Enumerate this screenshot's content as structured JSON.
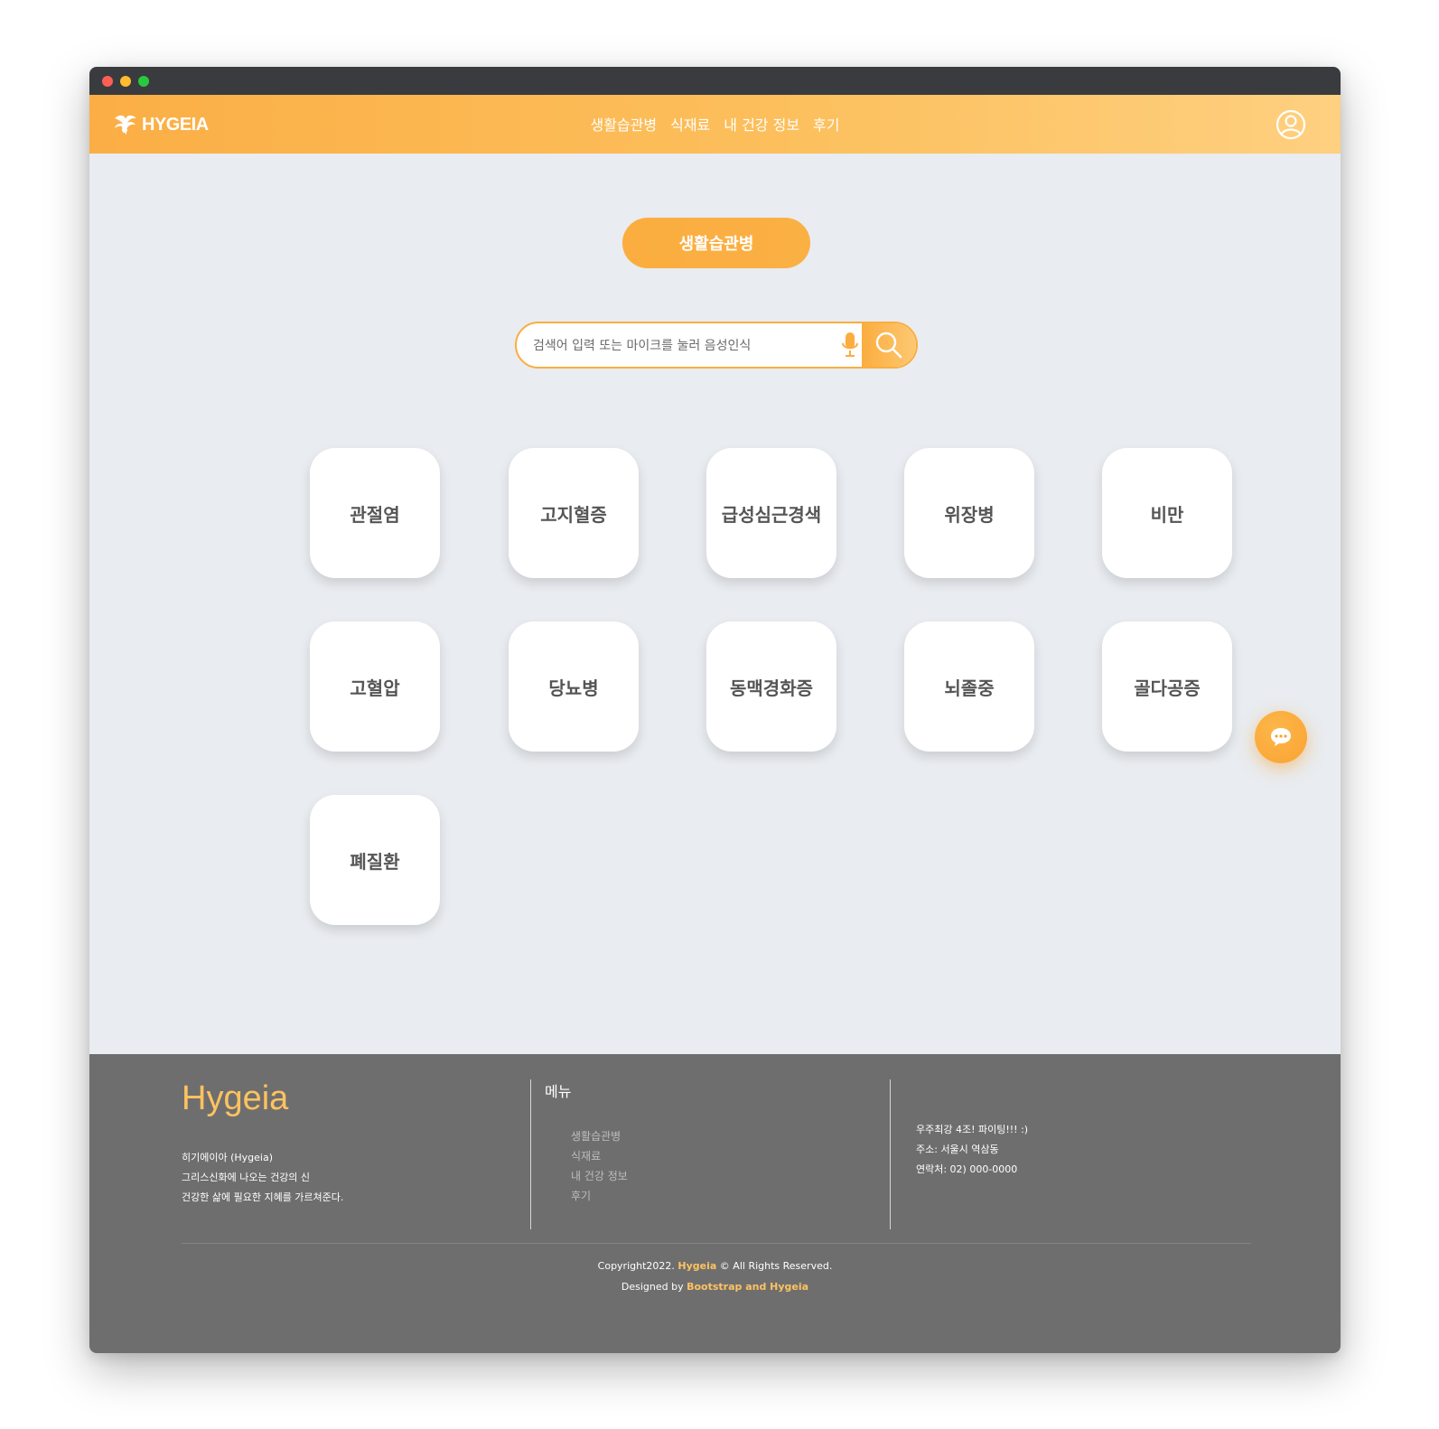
{
  "brand": {
    "name": "HYGEIA"
  },
  "nav": {
    "links": [
      "생활습관병",
      "식재료",
      "내 건강 정보",
      "후기"
    ]
  },
  "category": {
    "label": "생활습관병"
  },
  "search": {
    "placeholder": "검색어 입력 또는 마이크를 눌러 음성인식"
  },
  "diseases": [
    "관절염",
    "고지혈증",
    "급성심근경색",
    "위장병",
    "비만",
    "고혈압",
    "당뇨병",
    "동맥경화증",
    "뇌졸중",
    "골다공증",
    "폐질환"
  ],
  "footer": {
    "brand": "Hygeia",
    "desc_lines": [
      "히기에이아 (Hygeia)",
      "그리스신화에 나오는 건강의 신",
      "건강한 삶에 필요한 지혜를 가르쳐준다."
    ],
    "menu_title": "메뉴",
    "menu_items": [
      "생활습관병",
      "식재료",
      "내 건강 정보",
      "후기"
    ],
    "contact_lines": [
      "우주최강 4조! 파이팅!!! :)",
      "주소: 서울시 역삼동",
      "연락처: 02) 000-0000"
    ],
    "copyright_prefix": "Copyright2022. ",
    "copyright_brand": "Hygeia",
    "copyright_suffix": " © All Rights Reserved.",
    "designed_prefix": "Designed by ",
    "designed_by": "Bootstrap and Hygeia"
  },
  "colors": {
    "accent": "#fbad3f",
    "footer_bg": "#6f6e6f",
    "footer_highlight": "#fdc35f"
  }
}
